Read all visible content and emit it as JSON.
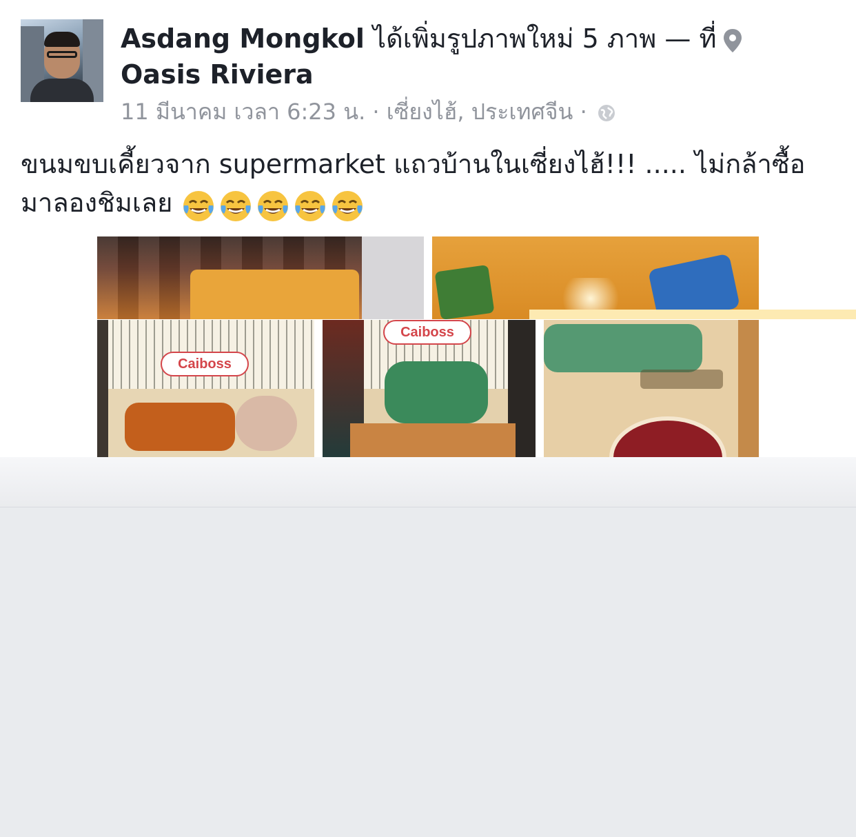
{
  "post": {
    "author": "Asdang Mongkol",
    "action": "ได้เพิ่มรูปภาพใหม่ 5 ภาพ — ที่",
    "location": "Oasis Riviera",
    "meta": "11 มีนาคม เวลา 6:23 น. · เซี่ยงไฮ้, ประเทศจีน ·",
    "text": "ขนมขบเคี้ยวจาก supermarket แถวบ้านในเซี่ยงไฮ้!!! ..... ไม่กล้าซื้อมาลองชิมเลย",
    "emoji": "face-with-tears-of-joy-icon",
    "emoji_count": 5,
    "photo_count": 5,
    "privacy_icon": "globe-icon",
    "location_icon": "map-pin-icon"
  },
  "colors": {
    "text": "#1d2129",
    "meta": "#90949c",
    "feed_background": "#e9ebee"
  }
}
